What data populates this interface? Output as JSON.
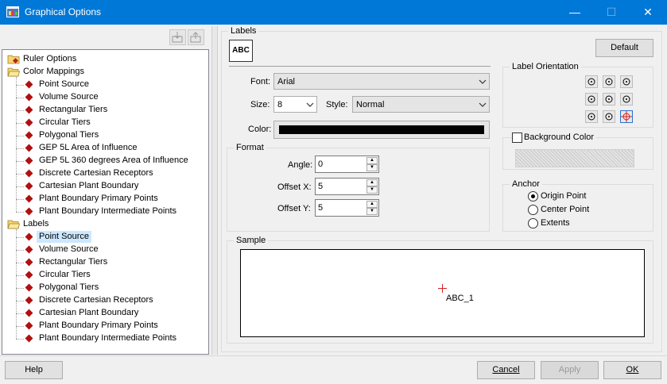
{
  "window": {
    "title": "Graphical Options",
    "minimize": "—",
    "maximize": "☐",
    "close": "✕"
  },
  "tree": [
    {
      "label": "Ruler Options",
      "level": 0,
      "icon": "folder-icon",
      "selected": false
    },
    {
      "label": "Color Mappings",
      "level": 0,
      "icon": "folder-open-icon",
      "selected": false
    },
    {
      "label": "Point Source",
      "level": 1,
      "icon": "diamond-icon",
      "selected": false
    },
    {
      "label": "Volume Source",
      "level": 1,
      "icon": "diamond-icon",
      "selected": false
    },
    {
      "label": "Rectangular Tiers",
      "level": 1,
      "icon": "diamond-icon",
      "selected": false
    },
    {
      "label": "Circular Tiers",
      "level": 1,
      "icon": "diamond-icon",
      "selected": false
    },
    {
      "label": "Polygonal Tiers",
      "level": 1,
      "icon": "diamond-icon",
      "selected": false
    },
    {
      "label": "GEP 5L Area of Influence",
      "level": 1,
      "icon": "diamond-icon",
      "selected": false
    },
    {
      "label": "GEP 5L 360 degrees Area of Influence",
      "level": 1,
      "icon": "diamond-icon",
      "selected": false
    },
    {
      "label": "Discrete Cartesian Receptors",
      "level": 1,
      "icon": "diamond-icon",
      "selected": false
    },
    {
      "label": "Cartesian Plant Boundary",
      "level": 1,
      "icon": "diamond-icon",
      "selected": false
    },
    {
      "label": "Plant Boundary Primary Points",
      "level": 1,
      "icon": "diamond-icon",
      "selected": false
    },
    {
      "label": "Plant Boundary Intermediate Points",
      "level": 1,
      "icon": "diamond-icon",
      "selected": false
    },
    {
      "label": "Labels",
      "level": 0,
      "icon": "folder-open-icon",
      "selected": false
    },
    {
      "label": "Point Source",
      "level": 1,
      "icon": "diamond-icon",
      "selected": true
    },
    {
      "label": "Volume Source",
      "level": 1,
      "icon": "diamond-icon",
      "selected": false
    },
    {
      "label": "Rectangular Tiers",
      "level": 1,
      "icon": "diamond-icon",
      "selected": false
    },
    {
      "label": "Circular Tiers",
      "level": 1,
      "icon": "diamond-icon",
      "selected": false
    },
    {
      "label": "Polygonal Tiers",
      "level": 1,
      "icon": "diamond-icon",
      "selected": false
    },
    {
      "label": "Discrete Cartesian Receptors",
      "level": 1,
      "icon": "diamond-icon",
      "selected": false
    },
    {
      "label": "Cartesian Plant Boundary",
      "level": 1,
      "icon": "diamond-icon",
      "selected": false
    },
    {
      "label": "Plant Boundary Primary Points",
      "level": 1,
      "icon": "diamond-icon",
      "selected": false
    },
    {
      "label": "Plant Boundary Intermediate Points",
      "level": 1,
      "icon": "diamond-icon",
      "selected": false
    }
  ],
  "labels_group": {
    "title": "Labels",
    "abc_icon_text": "ABC",
    "default_button": "Default",
    "font_label": "Font:",
    "font_value": "Arial",
    "size_label": "Size:",
    "size_value": "8",
    "style_label": "Style:",
    "style_value": "Normal",
    "color_label": "Color:",
    "color_value": "#000000"
  },
  "format": {
    "title": "Format",
    "angle_label": "Angle:",
    "angle_value": "0",
    "offset_x_label": "Offset X:",
    "offset_x_value": "5",
    "offset_y_label": "Offset Y:",
    "offset_y_value": "5"
  },
  "orientation": {
    "title": "Label Orientation",
    "selected": "bottom-right"
  },
  "background": {
    "label": "Background Color",
    "checked": false
  },
  "anchor": {
    "title": "Anchor",
    "options": [
      "Origin Point",
      "Center Point",
      "Extents"
    ],
    "selected": "Origin Point"
  },
  "sample": {
    "title": "Sample",
    "text": "ABC_1"
  },
  "buttons": {
    "help": "Help",
    "cancel": "Cancel",
    "apply": "Apply",
    "ok": "OK"
  }
}
